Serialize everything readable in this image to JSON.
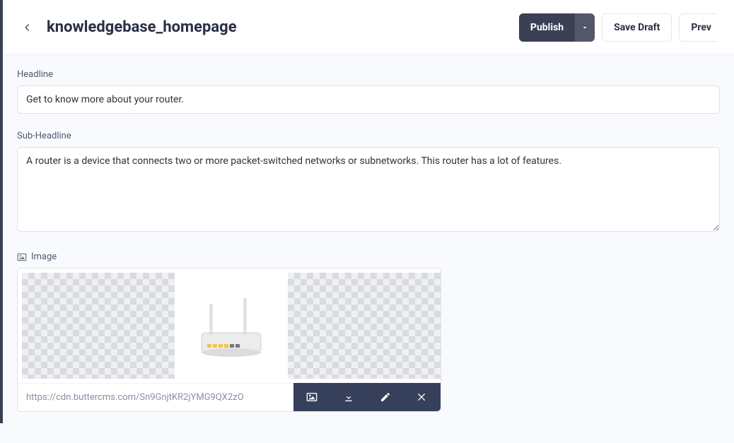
{
  "header": {
    "title": "knowledgebase_homepage",
    "publish_label": "Publish",
    "save_draft_label": "Save Draft",
    "preview_label": "Prev"
  },
  "fields": {
    "headline": {
      "label": "Headline",
      "value": "Get to know more about your router."
    },
    "subheadline": {
      "label": "Sub-Headline",
      "value": "A router is a device that connects two or more packet-switched networks or subnetworks. This router has a lot of features."
    },
    "image": {
      "label": "Image",
      "url": "https://cdn.buttercms.com/Sn9GnjtKR2jYMG9QX2zO"
    }
  }
}
